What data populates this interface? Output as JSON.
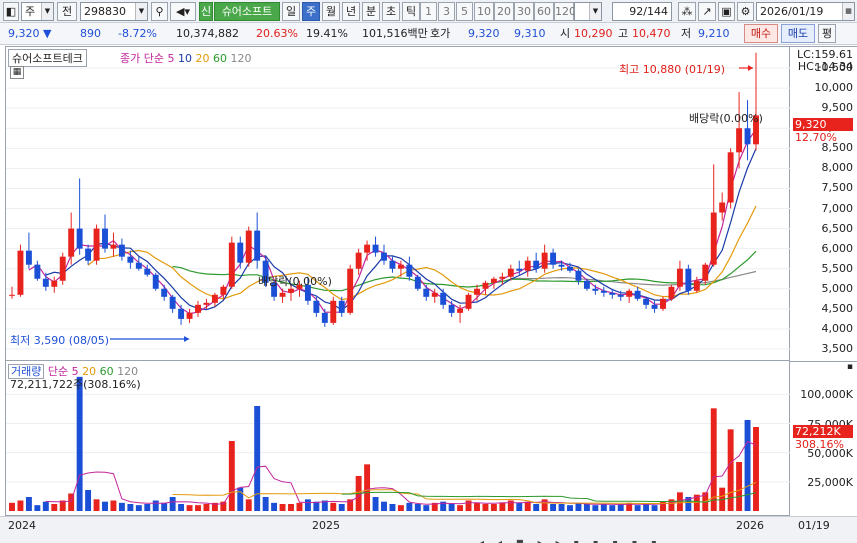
{
  "toolbar": {
    "type_label": "주",
    "mode_label": "전",
    "code": "298830",
    "sin_label": "신",
    "name_tab": "슈어소프트",
    "periods": [
      "일",
      "주",
      "월",
      "년",
      "분",
      "초",
      "틱"
    ],
    "active_period": "주",
    "minutes": [
      "1",
      "3",
      "5",
      "10",
      "20",
      "30",
      "60",
      "120"
    ],
    "count": "92",
    "count_total": "/144",
    "date": "2026/01/19"
  },
  "quote": {
    "price": "9,320",
    "change": "890",
    "change_pct": "-8.72%",
    "volume": "10,374,882",
    "vol_pct": "20.63%",
    "turnover": "19.41%",
    "amount": "101,516백만",
    "bid_label": "호가",
    "bid1": "9,320",
    "bid2": "9,310",
    "open_label": "시",
    "open": "10,290",
    "high_label": "고",
    "high": "10,470",
    "low_label": "저",
    "low": "9,210",
    "buy_btn": "매수",
    "sell_btn": "매도",
    "eval_btn": "평"
  },
  "price_panel": {
    "name_label": "슈어소프트테크",
    "ma_legend": "종가 단순",
    "ma_values": [
      "5",
      "10",
      "20",
      "60",
      "120"
    ],
    "lc": "LC:159.61",
    "hc": "HC:-14.34",
    "y_ticks": [
      "10,500",
      "10,000",
      "9,500",
      "9,000",
      "8,500",
      "8,000",
      "7,500",
      "7,000",
      "6,500",
      "6,000",
      "5,500",
      "5,000",
      "4,500",
      "4,000",
      "3,500"
    ],
    "current_tag": "9,320",
    "current_pct": "12.70%",
    "high_note": "최고 10,880 (01/19)",
    "low_note": "최저 3,590 (08/05)",
    "dividend_note1": "배당락(0.00%)",
    "dividend_note2": "배당락(0.00%)"
  },
  "volume_panel": {
    "title": "거래량",
    "ma_legend": "단순",
    "ma_values": [
      "5",
      "20",
      "60",
      "120"
    ],
    "value_label": "72,211,722주(308.16%)",
    "y_ticks": [
      "100,000K",
      "75,000K",
      "50,000K",
      "25,000K"
    ],
    "current_tag": "72,212K",
    "current_pct": "308.16%"
  },
  "x_axis": {
    "labels": [
      "2024",
      "2025",
      "2026"
    ],
    "end_label": "01/19"
  },
  "colors": {
    "up": "#e8231d",
    "down": "#1a4fd6",
    "ma5": "#c2269c",
    "ma10": "#1a3aa8",
    "ma20": "#e39a0c",
    "ma60": "#2d9a2d",
    "ma120": "#888888"
  },
  "chart_data": {
    "type": "candlestick",
    "weeks": 108,
    "y_range": [
      3300,
      10900
    ],
    "candles": [
      [
        4850,
        5050,
        4750,
        4850
      ],
      [
        4850,
        6100,
        4800,
        5950
      ],
      [
        5950,
        6400,
        5500,
        5600
      ],
      [
        5600,
        5700,
        5200,
        5250
      ],
      [
        5250,
        5400,
        4950,
        5050
      ],
      [
        5050,
        5300,
        4900,
        5200
      ],
      [
        5200,
        5900,
        5100,
        5800
      ],
      [
        5800,
        6900,
        5600,
        6500
      ],
      [
        6500,
        7750,
        5850,
        6000
      ],
      [
        6000,
        6100,
        5600,
        5700
      ],
      [
        5700,
        6600,
        5600,
        6500
      ],
      [
        6500,
        6850,
        5900,
        6000
      ],
      [
        6000,
        6400,
        5800,
        6100
      ],
      [
        6100,
        6250,
        5700,
        5800
      ],
      [
        5800,
        5950,
        5500,
        5650
      ],
      [
        5650,
        5800,
        5450,
        5500
      ],
      [
        5500,
        5600,
        5300,
        5350
      ],
      [
        5350,
        5400,
        4950,
        5000
      ],
      [
        5000,
        5100,
        4700,
        4800
      ],
      [
        4800,
        4850,
        4400,
        4500
      ],
      [
        4500,
        4600,
        4100,
        4250
      ],
      [
        4250,
        4500,
        4150,
        4400
      ],
      [
        4400,
        4700,
        4300,
        4600
      ],
      [
        4600,
        4750,
        4500,
        4650
      ],
      [
        4650,
        4900,
        4550,
        4850
      ],
      [
        4850,
        5100,
        4750,
        5050
      ],
      [
        5050,
        6300,
        5000,
        6150
      ],
      [
        6150,
        6300,
        5500,
        5650
      ],
      [
        5650,
        6550,
        5550,
        6450
      ],
      [
        6450,
        6900,
        5500,
        5700
      ],
      [
        5700,
        5800,
        5050,
        5150
      ],
      [
        5150,
        5200,
        4700,
        4800
      ],
      [
        4800,
        5000,
        4650,
        4900
      ],
      [
        4900,
        5100,
        4700,
        5000
      ],
      [
        5000,
        5200,
        4800,
        5100
      ],
      [
        5100,
        5300,
        4600,
        4700
      ],
      [
        4700,
        4800,
        4300,
        4400
      ],
      [
        4400,
        4500,
        4050,
        4150
      ],
      [
        4150,
        4800,
        4100,
        4700
      ],
      [
        4700,
        4800,
        4300,
        4400
      ],
      [
        4400,
        5600,
        4350,
        5500
      ],
      [
        5500,
        6000,
        5350,
        5900
      ],
      [
        5900,
        6200,
        5700,
        6100
      ],
      [
        6100,
        6300,
        5800,
        5900
      ],
      [
        5900,
        6100,
        5600,
        5700
      ],
      [
        5700,
        5800,
        5400,
        5500
      ],
      [
        5500,
        5700,
        5300,
        5600
      ],
      [
        5600,
        5800,
        5200,
        5300
      ],
      [
        5300,
        5350,
        4950,
        5000
      ],
      [
        5000,
        5100,
        4700,
        4800
      ],
      [
        4800,
        5000,
        4650,
        4900
      ],
      [
        4900,
        5000,
        4500,
        4600
      ],
      [
        4600,
        4700,
        4300,
        4400
      ],
      [
        4400,
        4600,
        4150,
        4500
      ],
      [
        4500,
        4900,
        4450,
        4850
      ],
      [
        4850,
        5100,
        4700,
        5000
      ],
      [
        5000,
        5200,
        4850,
        5150
      ],
      [
        5150,
        5300,
        5000,
        5250
      ],
      [
        5250,
        5400,
        5100,
        5300
      ],
      [
        5300,
        5600,
        5200,
        5500
      ],
      [
        5500,
        5700,
        5350,
        5450
      ],
      [
        5450,
        5800,
        5300,
        5700
      ],
      [
        5700,
        5900,
        5400,
        5500
      ],
      [
        5500,
        6100,
        5400,
        5900
      ],
      [
        5900,
        6000,
        5500,
        5600
      ],
      [
        5600,
        5700,
        5450,
        5550
      ],
      [
        5550,
        5650,
        5400,
        5450
      ],
      [
        5450,
        5500,
        5100,
        5200
      ],
      [
        5200,
        5250,
        4950,
        5000
      ],
      [
        5000,
        5100,
        4850,
        4950
      ],
      [
        4950,
        5050,
        4800,
        4900
      ],
      [
        4900,
        5000,
        4750,
        4850
      ],
      [
        4850,
        4950,
        4700,
        4800
      ],
      [
        4800,
        5000,
        4650,
        4950
      ],
      [
        4950,
        5050,
        4700,
        4750
      ],
      [
        4750,
        4800,
        4500,
        4600
      ],
      [
        4600,
        4700,
        4400,
        4500
      ],
      [
        4500,
        4800,
        4450,
        4750
      ],
      [
        4750,
        5100,
        4700,
        5050
      ],
      [
        5050,
        5700,
        4950,
        5500
      ],
      [
        5500,
        5600,
        4850,
        4950
      ],
      [
        4950,
        5300,
        4900,
        5200
      ],
      [
        5200,
        5650,
        5100,
        5600
      ],
      [
        5600,
        8100,
        5550,
        6900
      ],
      [
        6900,
        7400,
        6700,
        7150
      ],
      [
        7150,
        8500,
        7000,
        8400
      ],
      [
        8400,
        9900,
        8000,
        9000
      ],
      [
        9000,
        9700,
        8200,
        8600
      ],
      [
        8600,
        10880,
        8450,
        9320
      ]
    ],
    "volume": [
      7,
      9,
      12,
      5,
      8,
      6,
      9,
      15,
      115,
      18,
      10,
      8,
      9,
      7,
      6,
      5,
      6,
      9,
      7,
      12,
      6,
      5,
      5,
      6,
      7,
      8,
      60,
      20,
      10,
      90,
      12,
      7,
      6,
      6,
      7,
      10,
      8,
      9,
      7,
      6,
      10,
      30,
      40,
      12,
      8,
      6,
      5,
      7,
      6,
      5,
      7,
      8,
      6,
      5,
      9,
      7,
      6,
      6,
      7,
      9,
      7,
      8,
      6,
      10,
      6,
      6,
      5,
      7,
      6,
      5,
      6,
      5,
      6,
      7,
      5,
      6,
      5,
      8,
      10,
      16,
      12,
      14,
      16,
      88,
      20,
      70,
      42,
      78,
      72
    ]
  }
}
